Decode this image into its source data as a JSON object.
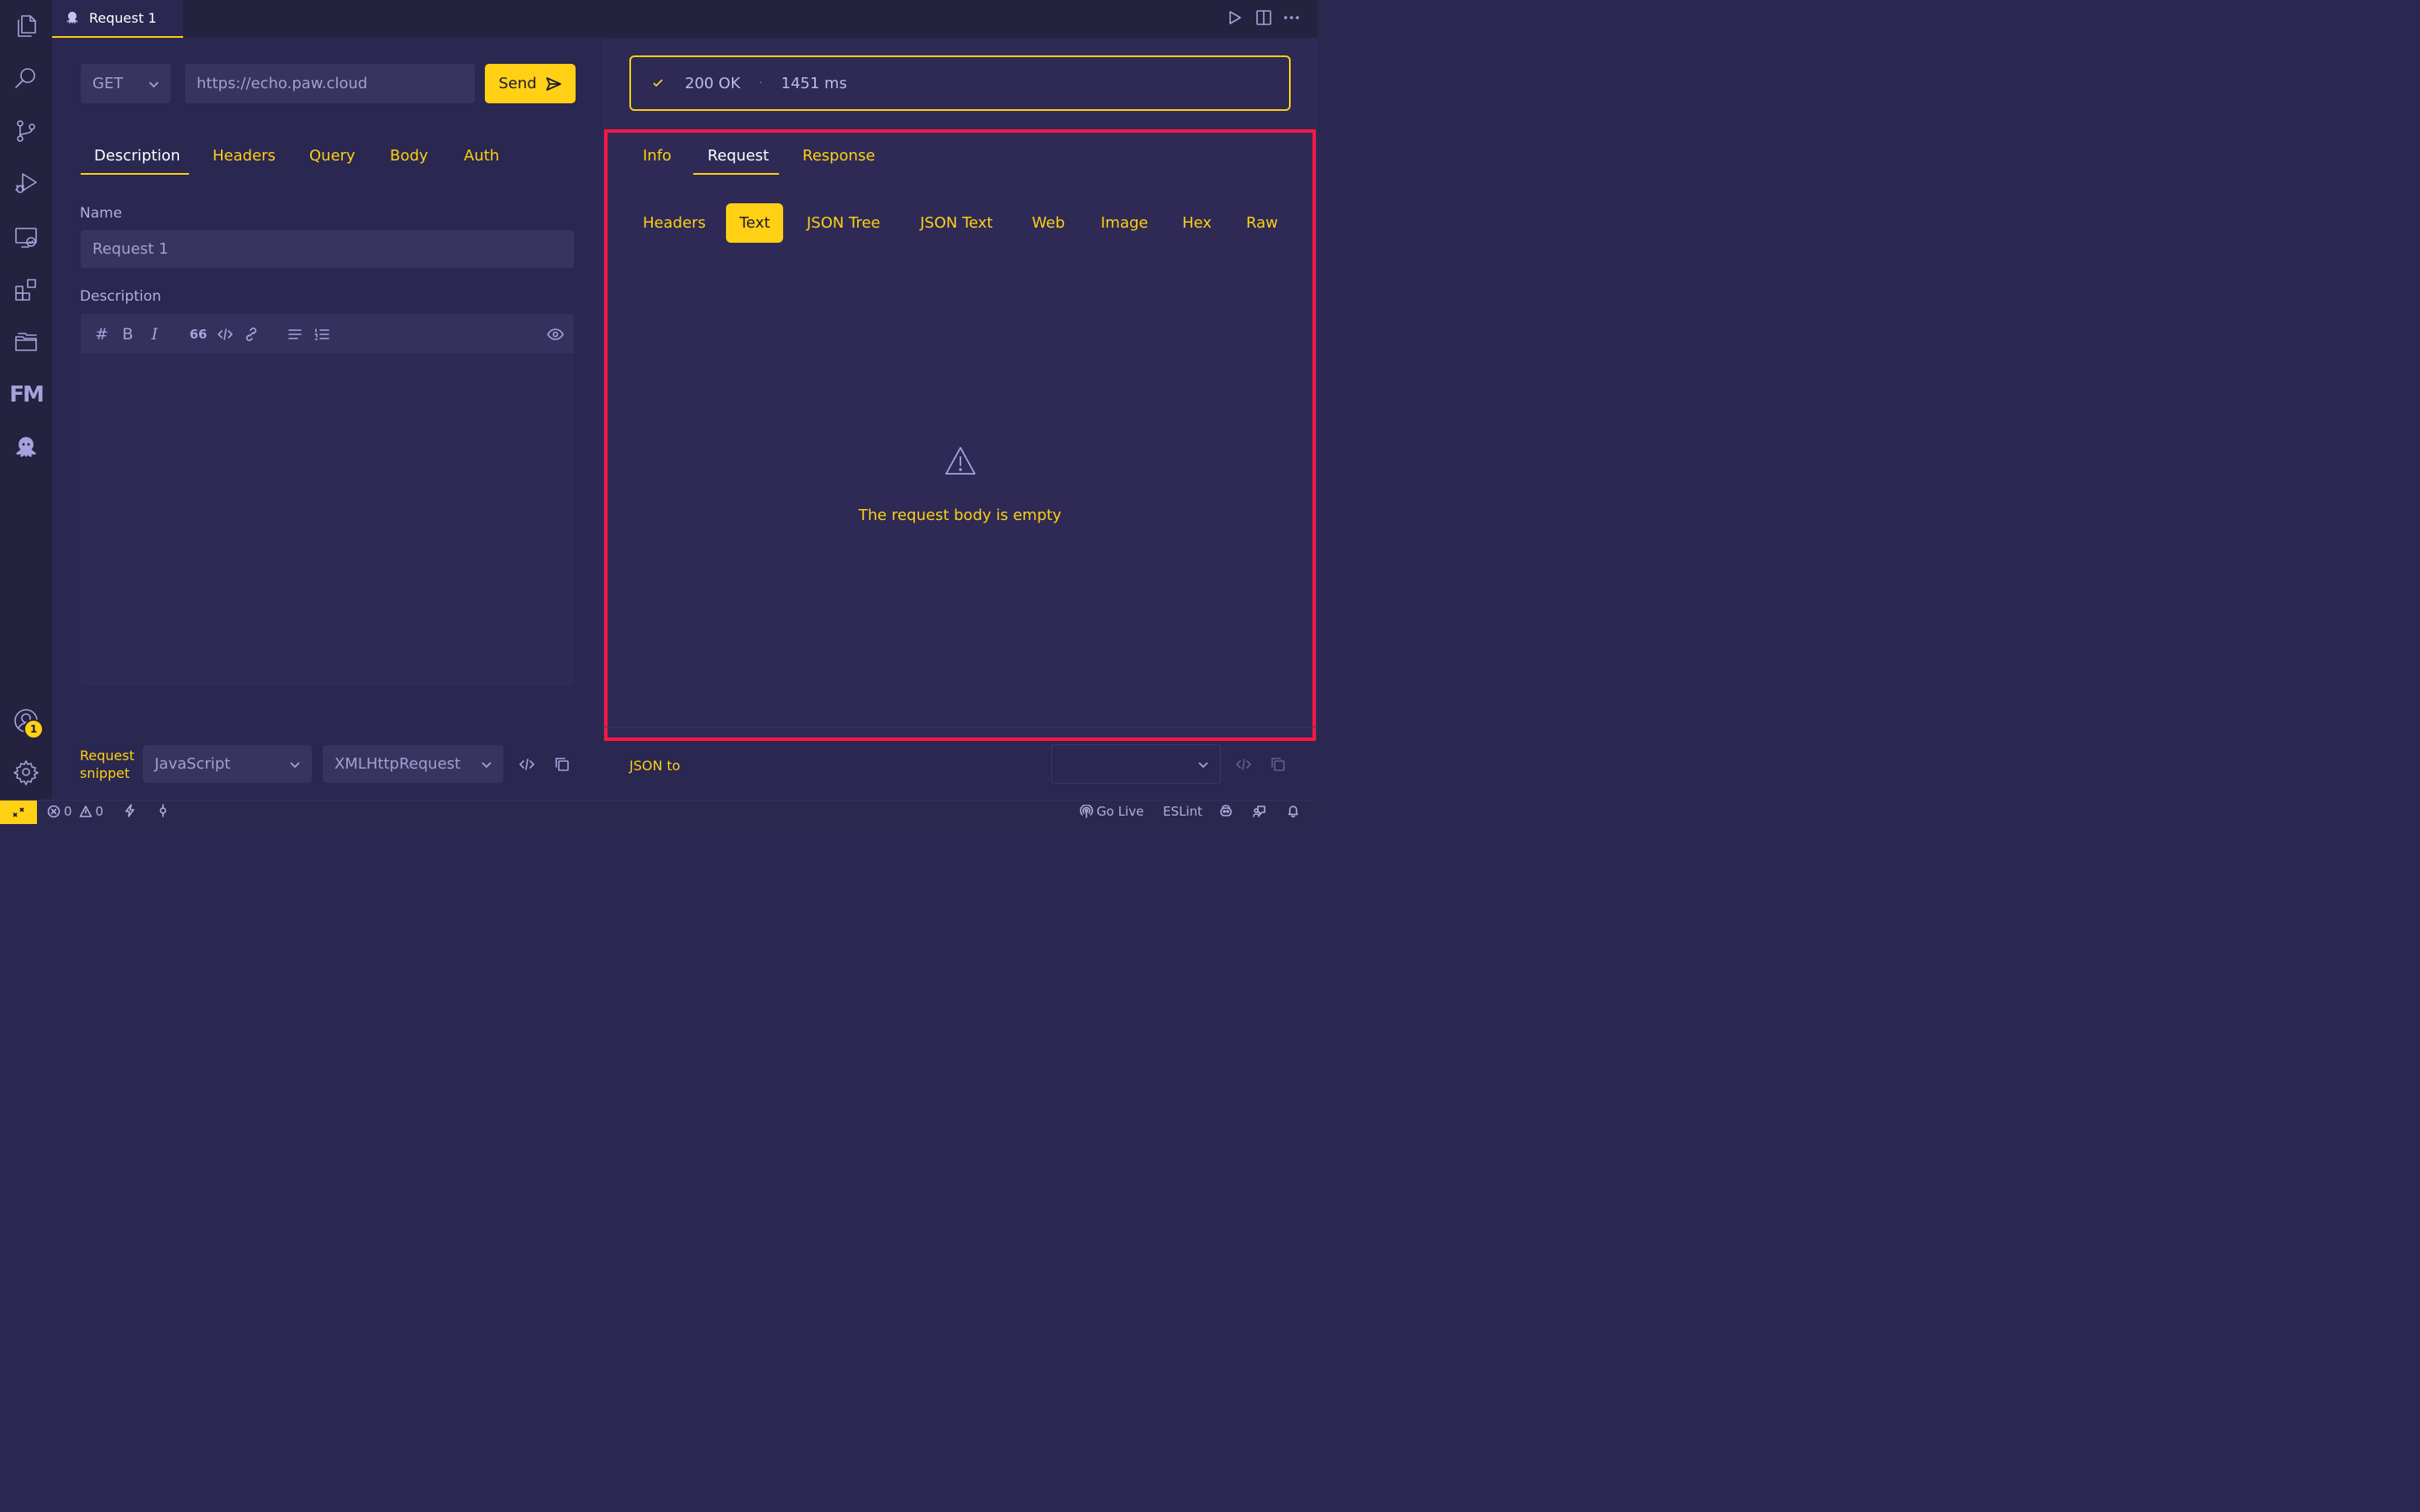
{
  "theme": {
    "accent": "#ffd013",
    "background": "#2a2750",
    "panel": "#2e2a55",
    "highlight_border": "#ff1744"
  },
  "activity_bar": {
    "icons": [
      "explorer-icon",
      "search-icon",
      "source-control-icon",
      "run-debug-icon",
      "remote-explorer-icon",
      "extensions-icon",
      "folders-icon",
      "fm-logo-icon",
      "paw-octopus-icon"
    ],
    "fm_label": "FM",
    "accounts_badge": "1"
  },
  "editor_tab": {
    "title": "Request 1"
  },
  "request": {
    "method": "GET",
    "url": "https://echo.paw.cloud",
    "send_label": "Send",
    "tabs": [
      {
        "label": "Description",
        "active": true
      },
      {
        "label": "Headers",
        "active": false
      },
      {
        "label": "Query",
        "active": false
      },
      {
        "label": "Body",
        "active": false
      },
      {
        "label": "Auth",
        "active": false
      }
    ],
    "name_label": "Name",
    "name_value": "Request 1",
    "description_label": "Description",
    "toolbar": {
      "heading": "#",
      "bold": "B",
      "italic": "I",
      "quote": "66"
    },
    "snippet_label_line1": "Request",
    "snippet_label_line2": "snippet",
    "snippet_language": "JavaScript",
    "snippet_library": "XMLHttpRequest"
  },
  "response": {
    "status": "200 OK",
    "separator": "·",
    "time": "1451 ms",
    "tabs": [
      {
        "label": "Info",
        "active": false
      },
      {
        "label": "Request",
        "active": true
      },
      {
        "label": "Response",
        "active": false
      }
    ],
    "view_tabs": [
      {
        "label": "Headers",
        "active": false
      },
      {
        "label": "Text",
        "active": true
      },
      {
        "label": "JSON Tree",
        "active": false
      },
      {
        "label": "JSON Text",
        "active": false
      },
      {
        "label": "Web",
        "active": false
      },
      {
        "label": "Image",
        "active": false
      },
      {
        "label": "Hex",
        "active": false
      },
      {
        "label": "Raw",
        "active": false
      }
    ],
    "empty_message": "The request body is empty",
    "json_to_label": "JSON to"
  },
  "status_bar": {
    "errors": "0",
    "warnings": "0",
    "go_live": "Go Live",
    "eslint": "ESLint"
  }
}
